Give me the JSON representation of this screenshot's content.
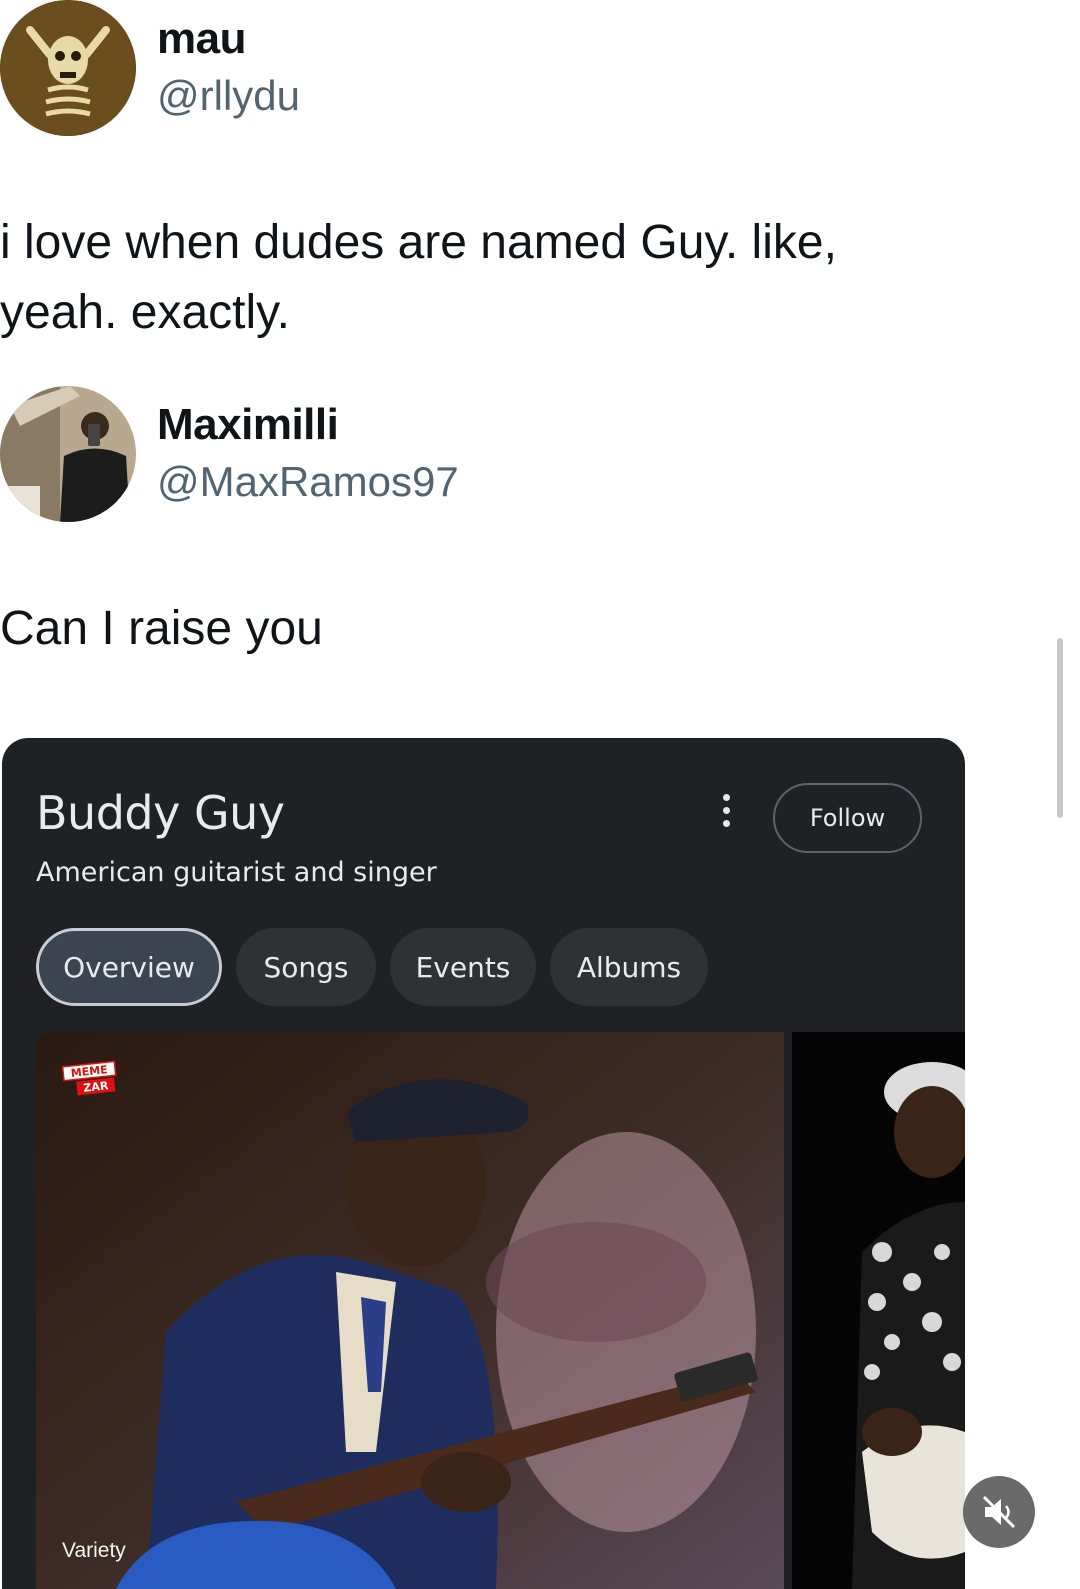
{
  "tweet1": {
    "name": "mau",
    "handle": "@rllydu",
    "text_line1": "i love when dudes are named Guy. like,",
    "text_line2": "yeah. exactly."
  },
  "tweet2": {
    "name": "Maximilli",
    "handle": "@MaxRamos97",
    "text": "Can I raise you"
  },
  "card": {
    "title": "Buddy Guy",
    "subtitle": "American guitarist and singer",
    "follow_label": "Follow",
    "tabs": [
      {
        "label": "Overview",
        "active": true
      },
      {
        "label": "Songs",
        "active": false
      },
      {
        "label": "Events",
        "active": false
      },
      {
        "label": "Albums",
        "active": false
      }
    ],
    "photo_credit": "Variety",
    "watermark_top": "MEME",
    "watermark_bottom": "ZAR"
  },
  "colors": {
    "card_bg": "#202124",
    "chip_bg": "#303134",
    "text_light": "#e8eaed",
    "handle_gray": "#536471"
  },
  "icons": {
    "more": "more-vert-icon",
    "mute": "volume-off-icon"
  }
}
